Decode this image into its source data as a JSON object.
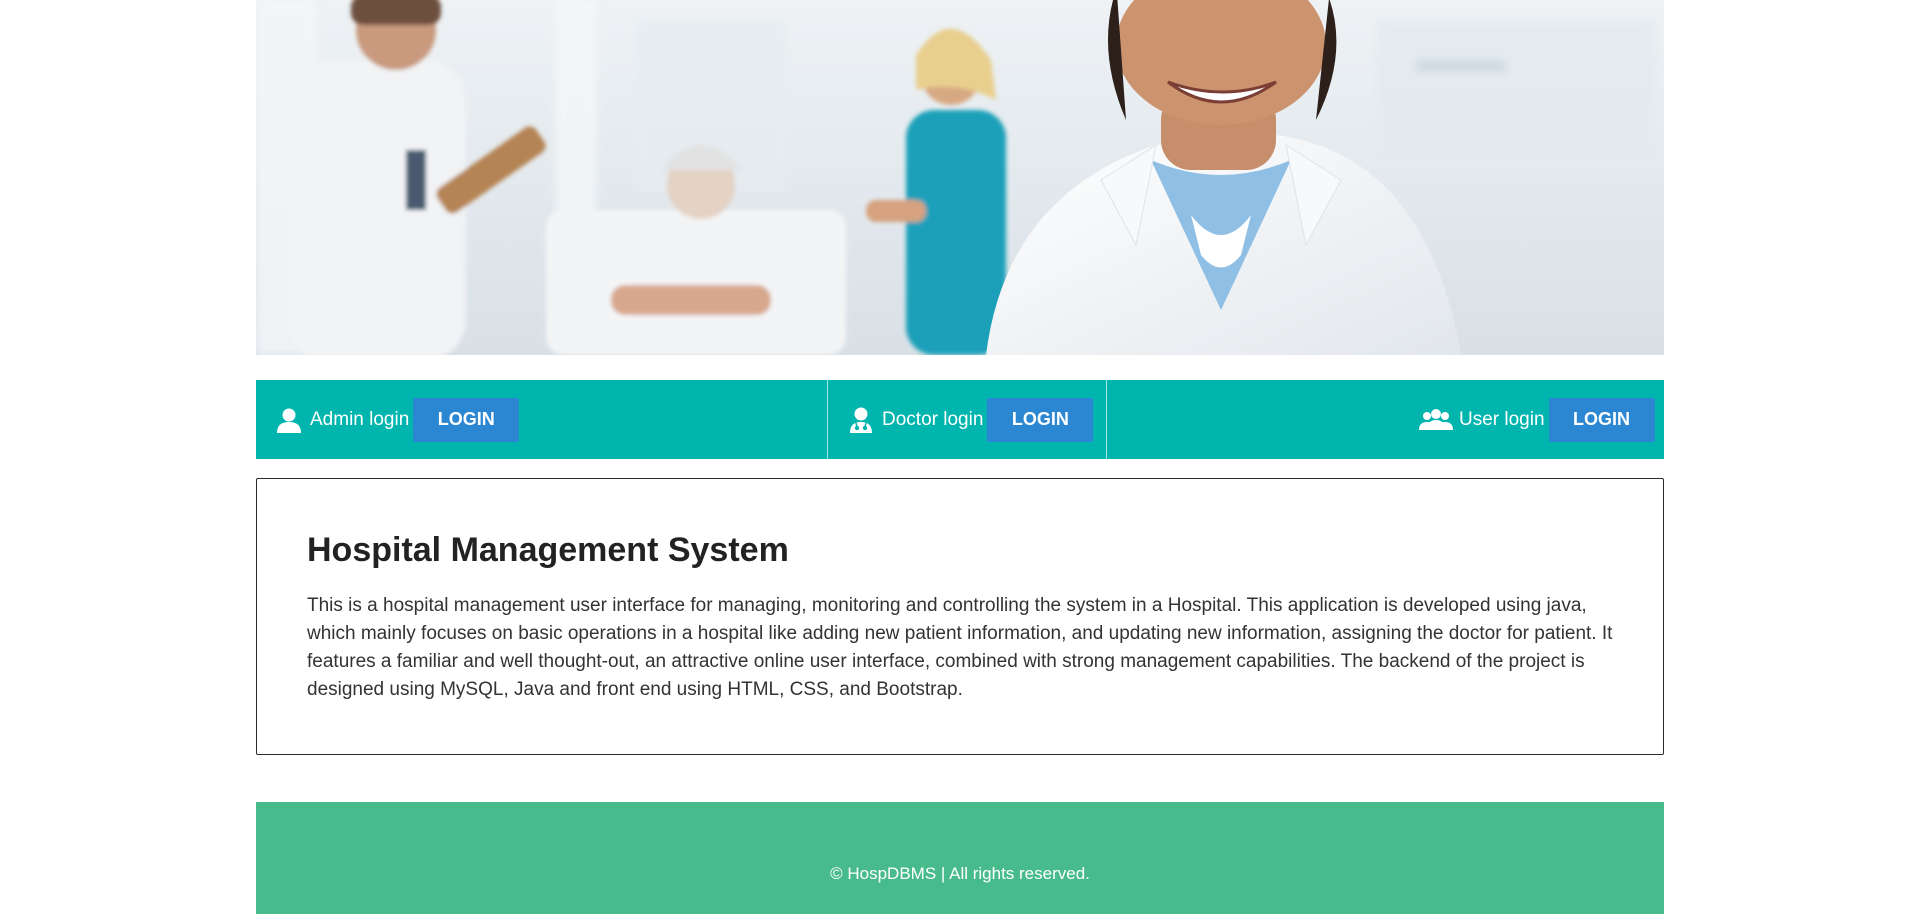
{
  "login_strip": {
    "admin": {
      "label": "Admin login",
      "button": "LOGIN",
      "icon": "user-icon"
    },
    "doctor": {
      "label": "Doctor login",
      "button": "LOGIN",
      "icon": "doctor-icon"
    },
    "user": {
      "label": "User login",
      "button": "LOGIN",
      "icon": "users-icon"
    }
  },
  "content": {
    "title": "Hospital Management System",
    "description": "This is a hospital management user interface for managing, monitoring and controlling the system in a Hospital. This application is developed using java, which mainly focuses on basic operations in a hospital like adding new patient information, and updating new information, assigning the doctor for patient. It features a familiar and well thought-out, an attractive online user interface, combined with strong management capabilities. The backend of the project is designed using MySQL, Java and front end using HTML, CSS, and Bootstrap."
  },
  "footer": {
    "copyright": "© HospDBMS | All rights reserved."
  },
  "colors": {
    "login_strip_bg": "#00b5ad",
    "login_button_bg": "#2c87d3",
    "footer_bg": "#48bb8d",
    "content_border": "#2b2b2b"
  }
}
